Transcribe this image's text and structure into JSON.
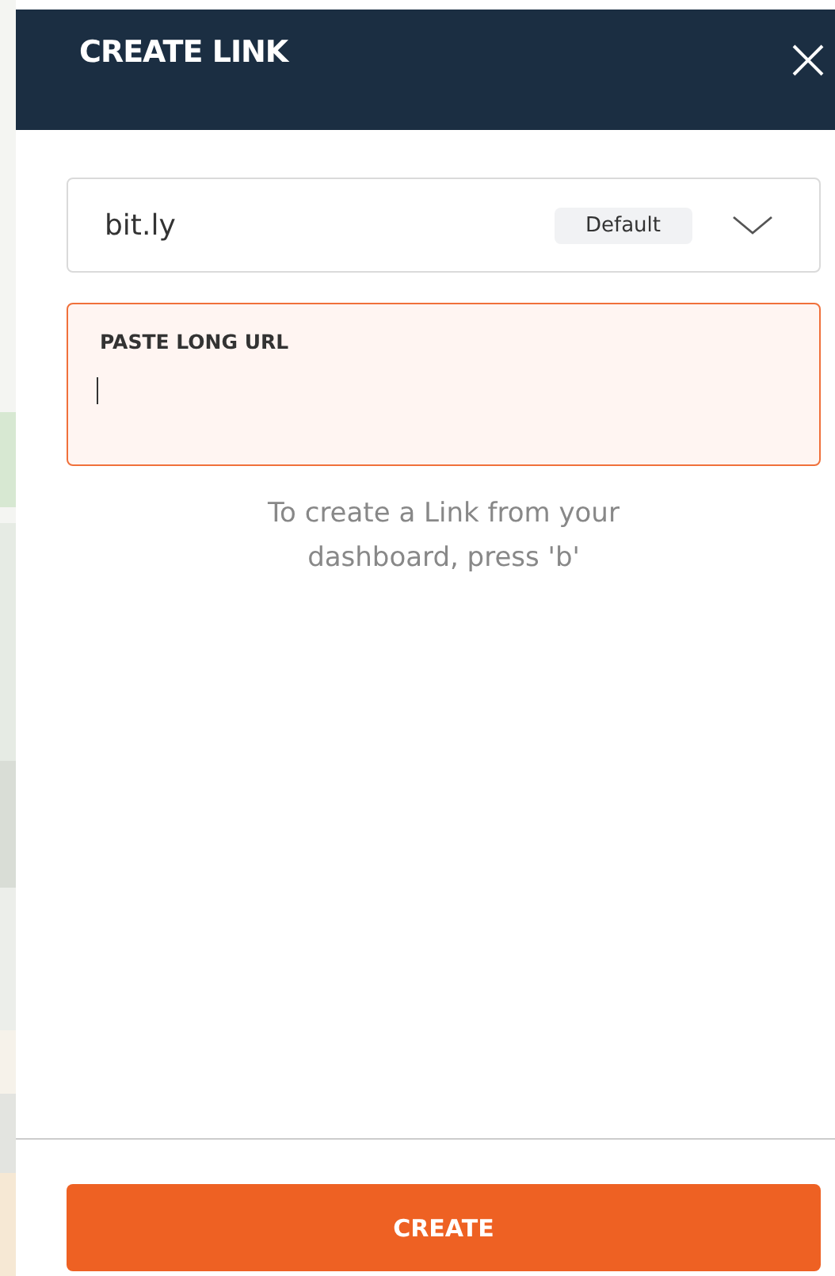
{
  "panel": {
    "title": "CREATE LINK"
  },
  "domain_select": {
    "value": "bit.ly",
    "badge": "Default",
    "expanded": false
  },
  "url_field": {
    "label": "PASTE LONG URL",
    "focused": true
  },
  "hint": "To create a Link from your dashboard, press 'b'",
  "buttons": [
    {
      "label": "CREATE"
    }
  ]
}
